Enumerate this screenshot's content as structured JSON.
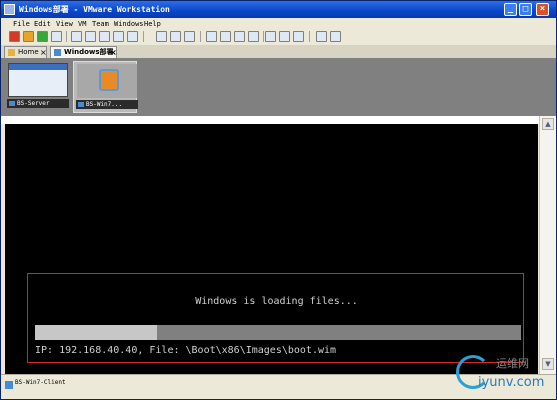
{
  "window": {
    "title": "Windows部署 - VMware Workstation",
    "minimize": "_",
    "maximize": "□",
    "close": "×"
  },
  "menu": [
    "File",
    "Edit",
    "View",
    "VM",
    "Team",
    "Windows",
    "Help"
  ],
  "toolbar_icons": [
    "power-off-icon",
    "suspend-icon",
    "power-on-icon",
    "reset-icon",
    "snapshot-icon",
    "revert-snapshot-icon",
    "snapshot-manager-icon",
    "vm-settings-icon",
    "clone-icon",
    "send-keys-icon",
    "normal-view-icon",
    "full-screen-icon",
    "quick-switch-icon",
    "unity-icon",
    "summary-view-icon",
    "console-view-icon",
    "thumbnail-icon",
    "help-icon"
  ],
  "tabs": [
    {
      "label": "Home",
      "close": "×"
    },
    {
      "label": "Windows部署",
      "close": "×"
    }
  ],
  "thumbnails": [
    "BS-Server",
    "BS-Win7..."
  ],
  "console": {
    "loading_text": "Windows is loading files...",
    "progress": 0.25,
    "ip_line": "IP: 192.168.40.40, File: \\Boot\\x86\\Images\\boot.wim"
  },
  "status": {
    "vm_name": "BS-Win7-Client"
  },
  "watermark": {
    "cn": "运维网",
    "en": "iyunv.com"
  },
  "colors": {
    "titlebar": "#0a46c8",
    "highlight_box": "#d0282b",
    "console_bg": "#000000",
    "progress_fill": "#c7c7c7",
    "progress_track": "#808080"
  }
}
